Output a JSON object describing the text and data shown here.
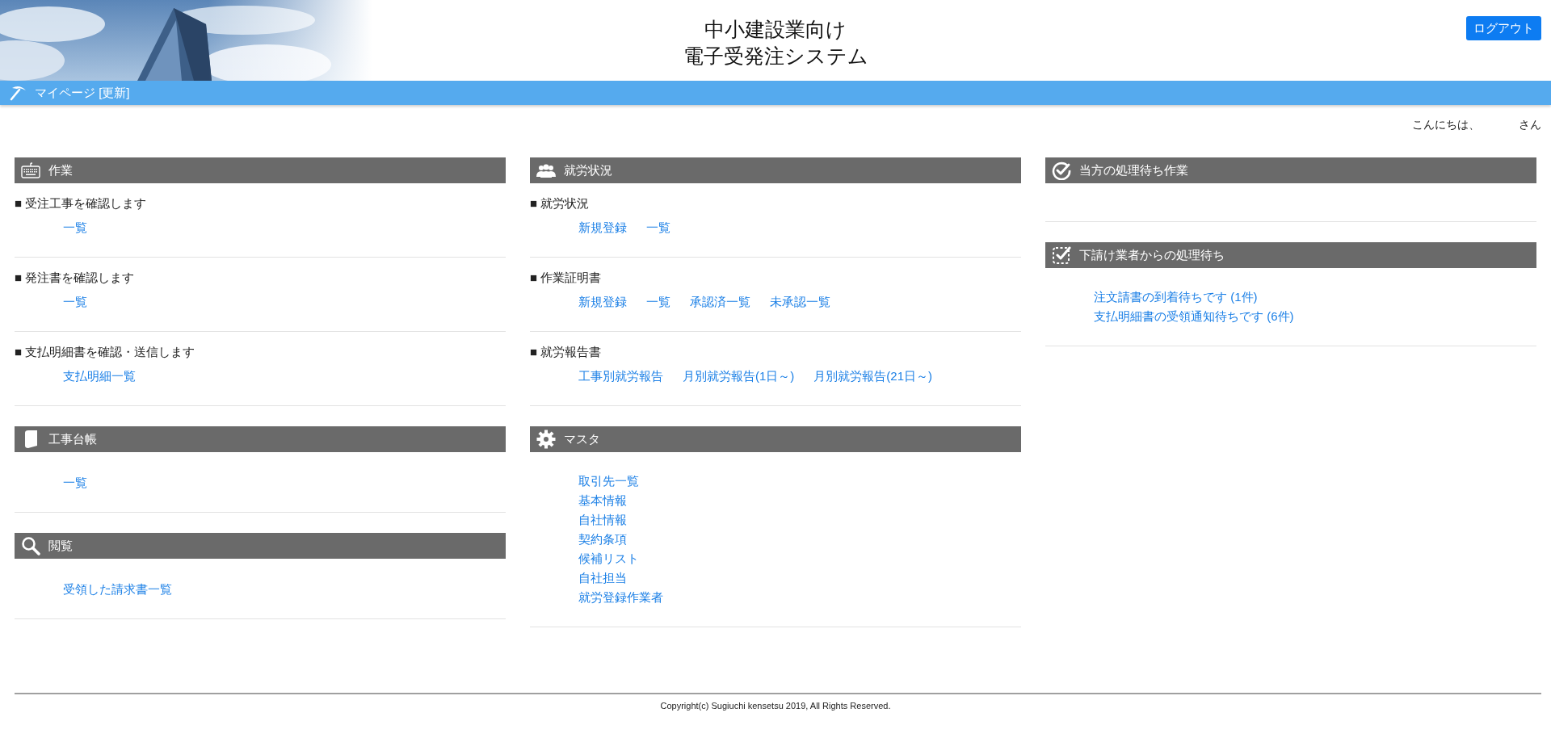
{
  "header": {
    "title_lines": [
      "中小建設業向け",
      "電子受発注システム"
    ],
    "logout_button": "ログアウト"
  },
  "nav_bar": {
    "label": "マイページ [更新]"
  },
  "greeting": {
    "prefix": "こんにちは、",
    "suffix": "さん"
  },
  "columns": [
    {
      "sections": [
        {
          "title": "作業",
          "groups": [
            {
              "heading": "■ 受注工事を確認します",
              "kind": "row",
              "links": [
                "一覧"
              ]
            },
            {
              "heading": "■ 発注書を確認します",
              "kind": "row",
              "links": [
                "一覧"
              ]
            },
            {
              "heading": "■ 支払明細書を確認・送信します",
              "kind": "row",
              "links": [
                "支払明細一覧"
              ]
            }
          ]
        },
        {
          "title": "工事台帳",
          "groups": [
            {
              "kind": "row",
              "links": [
                "一覧"
              ]
            }
          ]
        },
        {
          "title": "閲覧",
          "groups": [
            {
              "kind": "row",
              "links": [
                "受領した請求書一覧"
              ]
            }
          ]
        }
      ]
    },
    {
      "sections": [
        {
          "title": "就労状況",
          "groups": [
            {
              "heading": "■ 就労状況",
              "kind": "row",
              "links": [
                "新規登録",
                "一覧"
              ]
            },
            {
              "heading": "■ 作業証明書",
              "kind": "row",
              "links": [
                "新規登録",
                "一覧",
                "承認済一覧",
                "未承認一覧"
              ]
            },
            {
              "heading": "■ 就労報告書",
              "kind": "row",
              "links": [
                "工事別就労報告",
                "月別就労報告(1日～)",
                "月別就労報告(21日～)"
              ]
            }
          ]
        },
        {
          "title": "マスタ",
          "groups": [
            {
              "kind": "list",
              "links": [
                "取引先一覧",
                "基本情報",
                "自社情報",
                "契約条項",
                "候補リスト",
                "自社担当",
                "就労登録作業者"
              ]
            }
          ]
        }
      ]
    },
    {
      "sections": [
        {
          "title": "当方の処理待ち作業"
        },
        {
          "title": "下請け業者からの処理待ち",
          "groups": [
            {
              "kind": "list",
              "links": [
                "注文請書の到着待ちです (1件)",
                "支払明細書の受領通知待ちです (6件)"
              ]
            }
          ]
        }
      ]
    }
  ],
  "footer": {
    "copyright": "Copyright(c) Sugiuchi kensetsu 2019, All Rights Reserved."
  }
}
